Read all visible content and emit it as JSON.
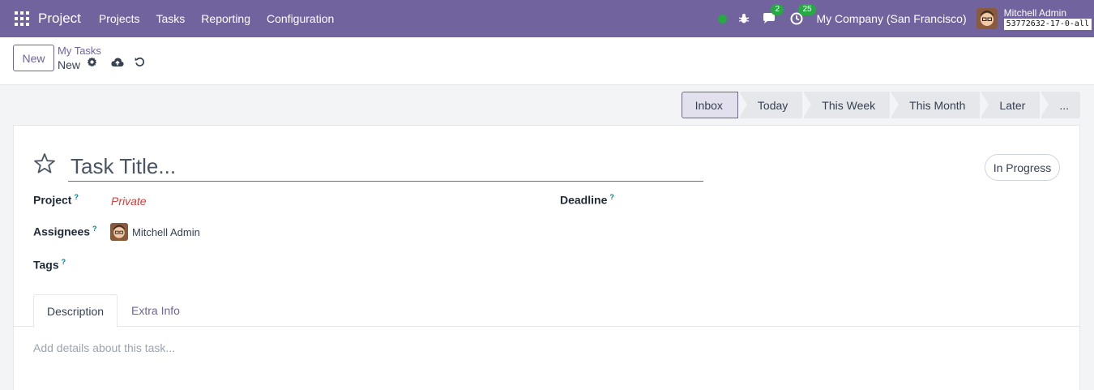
{
  "navbar": {
    "brand": "Project",
    "menu": [
      "Projects",
      "Tasks",
      "Reporting",
      "Configuration"
    ],
    "messages_count": "2",
    "activities_count": "25",
    "company": "My Company (San Francisco)",
    "user_name": "Mitchell Admin",
    "database": "53772632-17-0-all",
    "colors": {
      "bar": "#71639e",
      "badge": "#28a745"
    }
  },
  "control_panel": {
    "new_label": "New",
    "breadcrumb": "My Tasks",
    "record_name": "New"
  },
  "statusbar": {
    "stages": [
      "Inbox",
      "Today",
      "This Week",
      "This Month",
      "Later",
      "..."
    ],
    "active_stage": "Inbox"
  },
  "form": {
    "title_placeholder": "Task Title...",
    "state": "In Progress",
    "fields": {
      "project_label": "Project",
      "project_value": "Private",
      "assignees_label": "Assignees",
      "assignee_name": "Mitchell Admin",
      "tags_label": "Tags",
      "deadline_label": "Deadline",
      "help_marker": "?"
    },
    "tabs": [
      "Description",
      "Extra Info"
    ],
    "description_placeholder": "Add details about this task..."
  }
}
